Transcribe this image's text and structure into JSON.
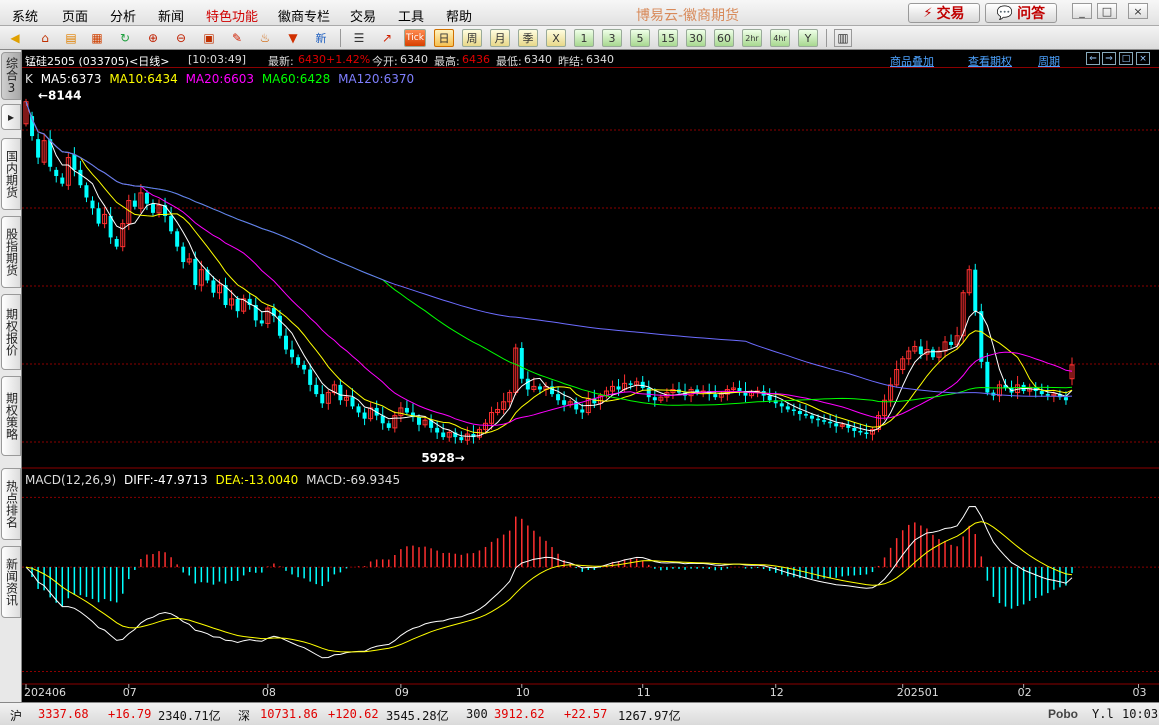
{
  "menu": [
    "系统",
    "页面",
    "分析",
    "新闻",
    "特色功能",
    "徽商专栏",
    "交易",
    "工具",
    "帮助"
  ],
  "app_title": "博易云-徽商期货",
  "buttons": {
    "trade": "交易",
    "ask": "问答",
    "trade_icon": "lightning-icon",
    "ask_icon": "chat-icon"
  },
  "window_controls": [
    "_",
    "□",
    "×"
  ],
  "toolbar": {
    "periods": [
      "日",
      "周",
      "月",
      "季",
      "X",
      "1",
      "3",
      "5",
      "15",
      "30",
      "60",
      "2hr",
      "4hr",
      "Y"
    ],
    "tick_label": "Tick",
    "new_label": "新"
  },
  "left_tabs": [
    "综合3",
    "国内期货",
    "股指期货",
    "期权报价",
    "期权策略",
    "热点排名",
    "新闻资讯"
  ],
  "quote": {
    "name": "锰硅2505 (033705)<日线>",
    "time": "[10:03:49]",
    "latest_label": "最新:",
    "latest": "6430",
    "change": "+1.42%",
    "open_label": "今开:",
    "open": "6340",
    "high_label": "最高:",
    "high": "6436",
    "low_label": "最低:",
    "low": "6340",
    "prev_label": "昨结:",
    "prev": "6340"
  },
  "header_links": [
    "商品叠加",
    "查看期权",
    "周期"
  ],
  "header_buttons": [
    "⇐",
    "⇒",
    "□",
    "×"
  ],
  "ma_legend": {
    "k": "K",
    "ma5": "MA5:6373",
    "ma10": "MA10:6434",
    "ma20": "MA20:6603",
    "ma60": "MA60:6428",
    "ma120": "MA120:6370"
  },
  "macd_legend": {
    "name": "MACD(12,26,9)",
    "diff": "DIFF:-47.9713",
    "dea": "DEA:-13.0040",
    "macd": "MACD:-69.9345"
  },
  "colors": {
    "up": "#ff3030",
    "down": "#00ffff",
    "ma5": "#ffffff",
    "ma10": "#ffff00",
    "ma20": "#ff00ff",
    "ma60": "#00ff00",
    "ma120": "#6c6cff",
    "grid": "#8b0000",
    "diff": "#ffffff",
    "dea": "#ffff00"
  },
  "chart_data": {
    "type": "candlestick",
    "price_annotations": {
      "max": "8144",
      "min": "5928"
    },
    "x_ticks": [
      {
        "label": "202406",
        "index": 0
      },
      {
        "label": "07",
        "index": 17
      },
      {
        "label": "08",
        "index": 40
      },
      {
        "label": "09",
        "index": 62
      },
      {
        "label": "10",
        "index": 82
      },
      {
        "label": "11",
        "index": 102
      },
      {
        "label": "12",
        "index": 124
      },
      {
        "label": "202501",
        "index": 145
      },
      {
        "label": "02",
        "index": 165
      },
      {
        "label": "03",
        "index": 184
      }
    ],
    "ylim": [
      5850,
      8220
    ],
    "close": [
      8144,
      7920,
      7780,
      7890,
      7720,
      7660,
      7610,
      7780,
      7700,
      7600,
      7520,
      7450,
      7350,
      7410,
      7260,
      7200,
      7350,
      7500,
      7460,
      7550,
      7480,
      7420,
      7470,
      7400,
      7300,
      7200,
      7100,
      7120,
      6950,
      7050,
      6980,
      6900,
      6950,
      6820,
      6860,
      6780,
      6860,
      6820,
      6720,
      6700,
      6800,
      6750,
      6620,
      6530,
      6480,
      6430,
      6400,
      6300,
      6240,
      6180,
      6250,
      6300,
      6200,
      6220,
      6160,
      6120,
      6080,
      6150,
      6100,
      6050,
      6020,
      6100,
      6150,
      6120,
      6090,
      6040,
      6070,
      6020,
      5990,
      5960,
      5990,
      5960,
      5940,
      5980,
      5960,
      6010,
      6050,
      6120,
      6140,
      6190,
      6250,
      6540,
      6340,
      6270,
      6290,
      6270,
      6290,
      6240,
      6200,
      6170,
      6190,
      6140,
      6120,
      6210,
      6180,
      6230,
      6260,
      6290,
      6270,
      6310,
      6300,
      6320,
      6280,
      6220,
      6200,
      6220,
      6250,
      6270,
      6250,
      6230,
      6270,
      6250,
      6260,
      6240,
      6220,
      6240,
      6270,
      6280,
      6260,
      6230,
      6250,
      6260,
      6230,
      6200,
      6180,
      6160,
      6140,
      6130,
      6110,
      6100,
      6080,
      6070,
      6060,
      6050,
      6030,
      6040,
      6020,
      6000,
      5990,
      5980,
      6010,
      6100,
      6200,
      6300,
      6400,
      6470,
      6520,
      6550,
      6500,
      6530,
      6480,
      6520,
      6580,
      6560,
      6620,
      6900,
      7050,
      6780,
      6450,
      6250,
      6230,
      6300,
      6280,
      6250,
      6300,
      6260,
      6280,
      6260,
      6240,
      6230,
      6240,
      6220,
      6200,
      6430
    ],
    "open": [
      8000,
      8050,
      7900,
      7750,
      7900,
      7700,
      7650,
      7600,
      7800,
      7700,
      7600,
      7500,
      7450,
      7350,
      7400,
      7250,
      7200,
      7350,
      7500,
      7450,
      7550,
      7480,
      7420,
      7470,
      7400,
      7300,
      7200,
      7100,
      7120,
      6950,
      7050,
      6980,
      6900,
      6950,
      6820,
      6860,
      6780,
      6860,
      6820,
      6720,
      6700,
      6800,
      6750,
      6620,
      6530,
      6480,
      6430,
      6400,
      6300,
      6240,
      6180,
      6250,
      6300,
      6200,
      6220,
      6160,
      6120,
      6080,
      6150,
      6100,
      6050,
      6020,
      6100,
      6150,
      6120,
      6090,
      6040,
      6070,
      6020,
      5990,
      5960,
      5990,
      5960,
      5940,
      5980,
      5960,
      6010,
      6050,
      6120,
      6140,
      6190,
      6250,
      6540,
      6340,
      6270,
      6290,
      6270,
      6290,
      6240,
      6200,
      6170,
      6190,
      6140,
      6120,
      6210,
      6180,
      6230,
      6260,
      6290,
      6270,
      6310,
      6300,
      6320,
      6280,
      6220,
      6200,
      6220,
      6250,
      6270,
      6250,
      6230,
      6270,
      6250,
      6260,
      6240,
      6220,
      6240,
      6270,
      6280,
      6260,
      6230,
      6250,
      6260,
      6230,
      6200,
      6180,
      6160,
      6140,
      6130,
      6110,
      6100,
      6080,
      6070,
      6060,
      6050,
      6030,
      6040,
      6020,
      6000,
      5990,
      5980,
      6010,
      6100,
      6200,
      6300,
      6400,
      6470,
      6520,
      6550,
      6500,
      6530,
      6480,
      6520,
      6580,
      6560,
      6620,
      6900,
      7050,
      6780,
      6450,
      6250,
      6230,
      6300,
      6280,
      6250,
      6300,
      6260,
      6280,
      6260,
      6240,
      6230,
      6240,
      6220,
      6340
    ],
    "ma5_last": 6373,
    "ma10_last": 6434,
    "ma20_last": 6603,
    "ma60_last": 6428,
    "ma120_last": 6370,
    "macd": {
      "diff_last": -47.9713,
      "dea_last": -13.004,
      "macd_last": -69.9345,
      "ylim": [
        -330,
        250
      ]
    }
  },
  "status": {
    "sh_label": "沪",
    "sh_val": "3337.68",
    "sh_chg": "+16.79",
    "sh_amt": "2340.71亿",
    "sz_label": "深",
    "sz_val": "10731.86",
    "sz_chg": "+120.62",
    "sz_amt": "3545.28亿",
    "c300_label": "300",
    "c300_val": "3912.62",
    "c300_chg": "+22.57",
    "c300_amt": "1267.97亿",
    "brand": "Pobo",
    "signal_icon": "signal-icon",
    "time": "10:03"
  }
}
